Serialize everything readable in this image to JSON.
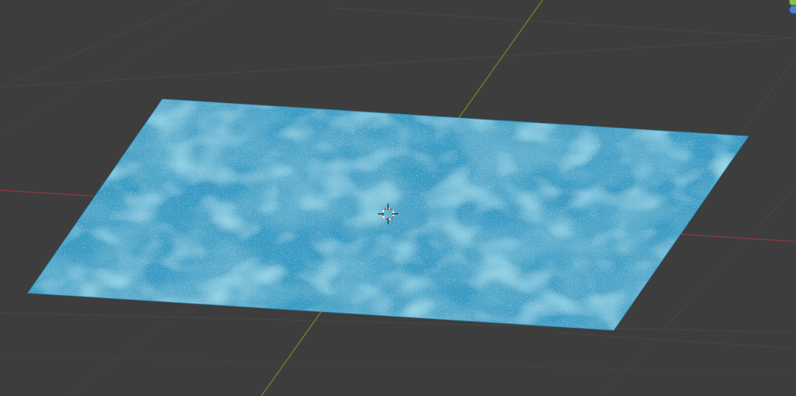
{
  "viewport": {
    "background_color": "#3d3d3d",
    "grid_color": "#4a4a4a",
    "x_axis_color": "#8c3a3f",
    "y_axis_color": "#6f8a2a",
    "view": "perspective"
  },
  "plane": {
    "object": "plane",
    "material": "water",
    "base_color": "#3a9cc4",
    "dark_color": "#2c7fa8",
    "light_color": "#5cc4e0",
    "highlight_color": "#b9ecf7"
  },
  "cursor_3d": {
    "icon": "3d-cursor-icon",
    "ring_color": "#ffffff",
    "accent_color": "#d23c3c"
  },
  "navigation_gizmo": {
    "y_axis_icon": "gizmo-y-axis-icon",
    "z_axis_icon": "gizmo-z-axis-icon",
    "y_color": "#8bc53f",
    "z_color": "#4f7ed6"
  }
}
